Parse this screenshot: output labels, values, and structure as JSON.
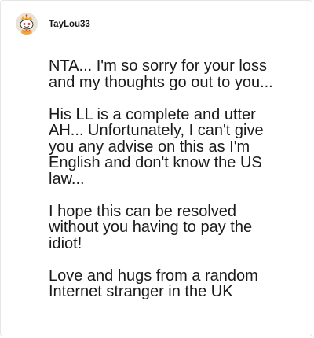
{
  "comment": {
    "username": "TayLou33",
    "avatar_icon": "snoo-avatar-icon",
    "paragraphs": [
      [
        "NTA... I'm so sorry for your loss",
        "and my thoughts go out to you..."
      ],
      [
        "His LL is a complete and utter",
        "AH... Unfortunately, I can't give",
        "you any advise on this as I'm",
        "English and don't know the US",
        "law..."
      ],
      [
        "I hope this can be resolved",
        "without you having to pay the",
        "idiot!"
      ],
      [
        "Love and hugs from a random",
        "Internet stranger in the UK"
      ]
    ]
  },
  "colors": {
    "text": "#1a1a1b",
    "avatar_bg": "#e9e2d6",
    "accent_orange": "#f0a534",
    "accent_red": "#d93b2b"
  }
}
